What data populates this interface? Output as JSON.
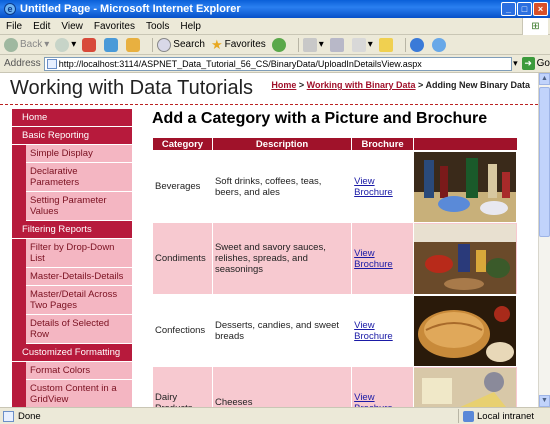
{
  "window": {
    "title": "Untitled Page - Microsoft Internet Explorer"
  },
  "menu": [
    "File",
    "Edit",
    "View",
    "Favorites",
    "Tools",
    "Help"
  ],
  "toolbar": {
    "back": "Back",
    "search": "Search",
    "favorites": "Favorites"
  },
  "address": {
    "label": "Address",
    "url": "http://localhost:3114/ASPNET_Data_Tutorial_56_CS/BinaryData/UploadInDetailsView.aspx",
    "go": "Go"
  },
  "site": {
    "title": "Working with Data Tutorials"
  },
  "breadcrumb": {
    "home": "Home",
    "sep": ">",
    "parent": "Working with Binary Data",
    "current": "Adding New Binary Data"
  },
  "sidebar": [
    {
      "type": "head",
      "label": "Home"
    },
    {
      "type": "head",
      "label": "Basic Reporting"
    },
    {
      "type": "sub",
      "label": "Simple Display"
    },
    {
      "type": "sub",
      "label": "Declarative Parameters"
    },
    {
      "type": "sub",
      "label": "Setting Parameter Values"
    },
    {
      "type": "head",
      "label": "Filtering Reports"
    },
    {
      "type": "sub",
      "label": "Filter by Drop-Down List"
    },
    {
      "type": "sub",
      "label": "Master-Details-Details"
    },
    {
      "type": "sub",
      "label": "Master/Detail Across Two Pages"
    },
    {
      "type": "sub",
      "label": "Details of Selected Row"
    },
    {
      "type": "head",
      "label": "Customized Formatting"
    },
    {
      "type": "sub",
      "label": "Format Colors"
    },
    {
      "type": "sub",
      "label": "Custom Content in a GridView"
    }
  ],
  "main": {
    "heading": "Add a Category with a Picture and Brochure",
    "columns": [
      "Category",
      "Description",
      "Brochure"
    ],
    "rows": [
      {
        "category": "Beverages",
        "description": "Soft drinks, coffees, teas, beers, and ales",
        "brochure": "View Brochure"
      },
      {
        "category": "Condiments",
        "description": "Sweet and savory sauces, relishes, spreads, and seasonings",
        "brochure": "View Brochure"
      },
      {
        "category": "Confections",
        "description": "Desserts, candies, and sweet breads",
        "brochure": "View Brochure"
      },
      {
        "category": "Dairy Products",
        "description": "Cheeses",
        "brochure": "View Brochure"
      }
    ]
  },
  "status": {
    "left": "Done",
    "zone": "Local intranet"
  },
  "colors": {
    "accent": "#a0122a",
    "sidebar_head": "#b71a3c",
    "sidebar_sub": "#f4b6c2",
    "row_alt": "#f7c9d0"
  }
}
